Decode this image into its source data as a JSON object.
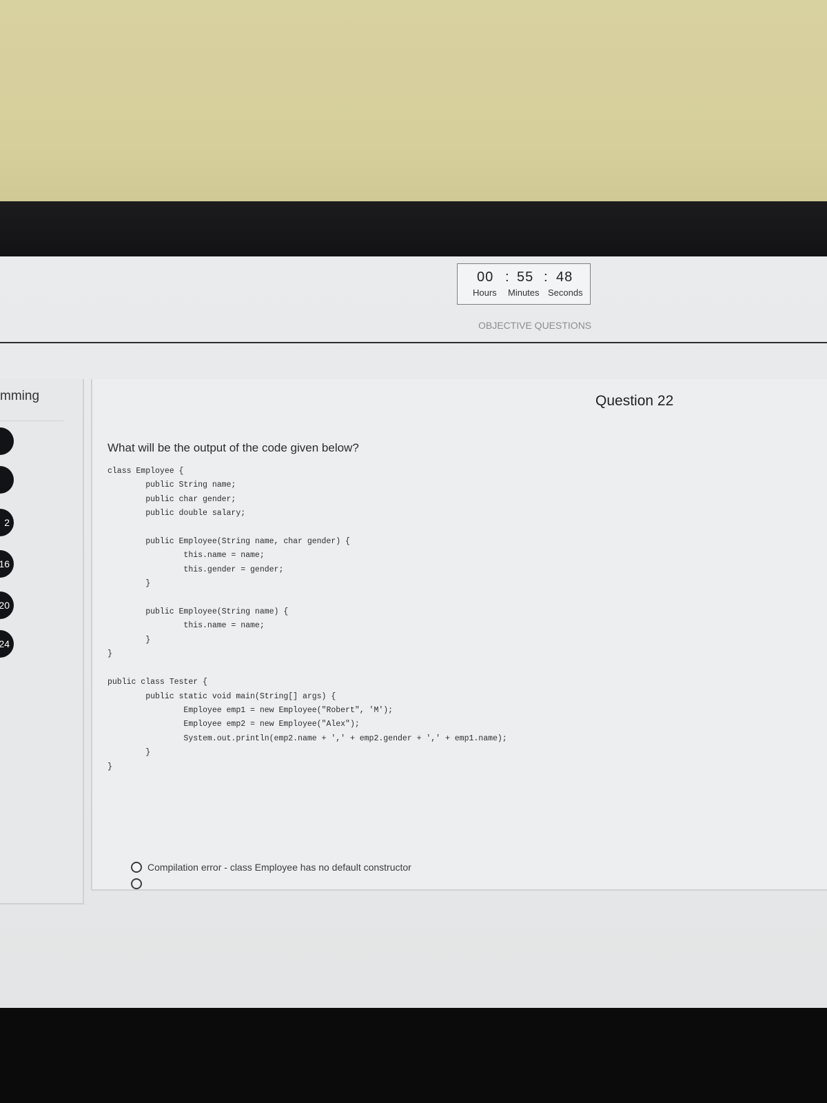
{
  "timer": {
    "hours": "00",
    "sep1": ":",
    "minutes": "55",
    "sep2": ":",
    "seconds": "48",
    "hours_label": "Hours",
    "minutes_label": "Minutes",
    "seconds_label": "Seconds"
  },
  "section_title": "OBJECTIVE QUESTIONS",
  "sidebar": {
    "title": "mming",
    "question_numbers": [
      "",
      "",
      "2",
      "16",
      "20",
      "24"
    ]
  },
  "question": {
    "number_label": "Question 22",
    "prompt": "What will be the output of the code given below?",
    "code": "class Employee {\n        public String name;\n        public char gender;\n        public double salary;\n\n        public Employee(String name, char gender) {\n                this.name = name;\n                this.gender = gender;\n        }\n\n        public Employee(String name) {\n                this.name = name;\n        }\n}\n\npublic class Tester {\n        public static void main(String[] args) {\n                Employee emp1 = new Employee(\"Robert\", 'M');\n                Employee emp2 = new Employee(\"Alex\");\n                System.out.println(emp2.name + ',' + emp2.gender + ',' + emp1.name);\n        }\n}",
    "options": [
      "Compilation error - class Employee has no default constructor"
    ]
  }
}
